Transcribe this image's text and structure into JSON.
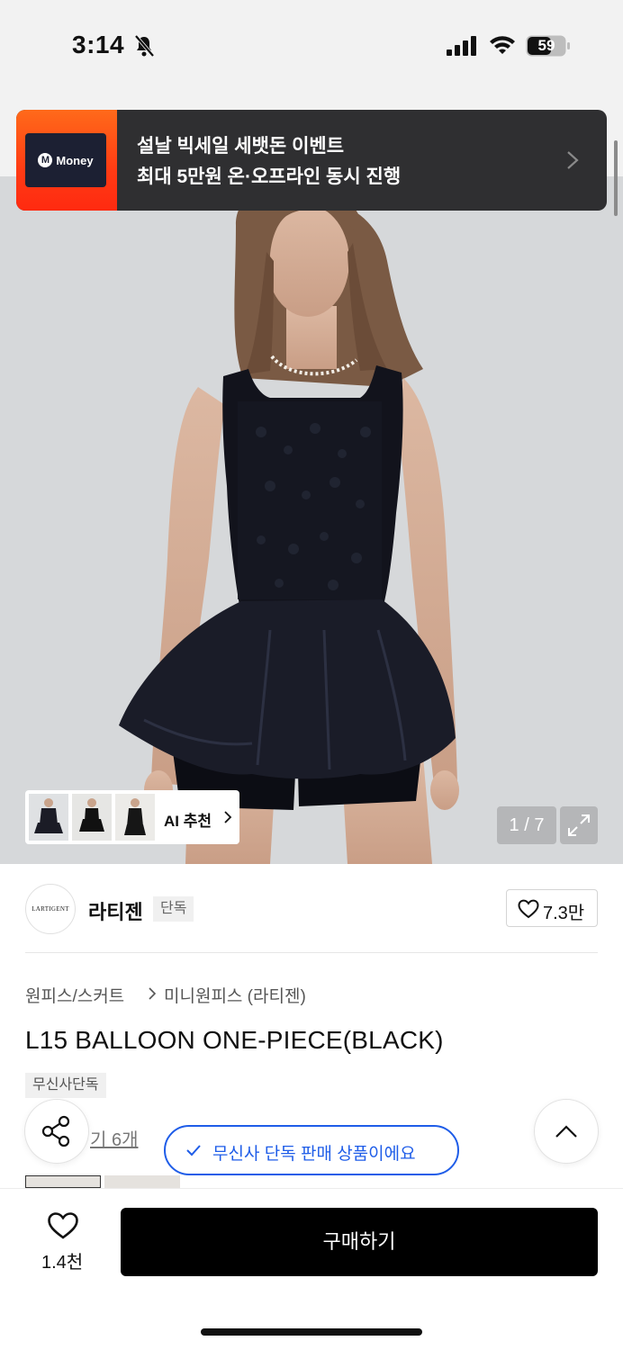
{
  "status_bar": {
    "time": "3:14",
    "battery": "59"
  },
  "banner": {
    "logo_text": "Money",
    "line1": "설날 빅세일 세뱃돈 이벤트",
    "line2": "최대 5만원 온·오프라인 동시 진행"
  },
  "gallery": {
    "ai_label": "AI 추천",
    "page_counter": "1 / 7"
  },
  "brand": {
    "logo_text": "LARTIGENT",
    "name": "라티젠",
    "badge": "단독",
    "like_count": "7.3만"
  },
  "breadcrumb": {
    "category": "원피스/스커트",
    "subcategory": "미니원피스 (라티젠)"
  },
  "product": {
    "title": "L15 BALLOON ONE-PIECE(BLACK)",
    "exclusive_tag": "무신사단독",
    "review_link": "기 6개"
  },
  "toast": {
    "text": "무신사 단독 판매 상품이에요"
  },
  "bottom_bar": {
    "wish_count": "1.4천",
    "buy_label": "구매하기"
  },
  "colors": {
    "accent_blue": "#1f5de8",
    "banner_bg": "#2f2f31",
    "banner_logo_orange": "#ff3b14",
    "buy_button": "#000000"
  }
}
